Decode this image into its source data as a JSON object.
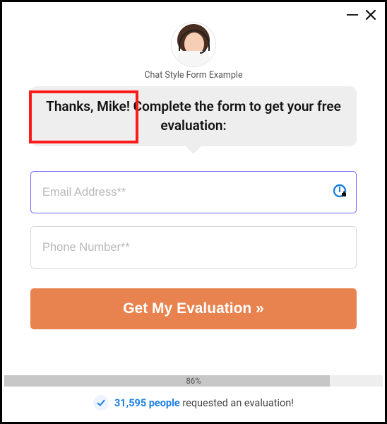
{
  "header": {
    "example_label": "Chat Style Form Example"
  },
  "bubble": {
    "text": "Thanks, Mike! Complete the form to get your free evaluation:"
  },
  "form": {
    "email_placeholder": "Email Address**",
    "phone_placeholder": "Phone Number**",
    "submit_label": "Get My Evaluation »"
  },
  "progress": {
    "percent": 86,
    "label": "86%"
  },
  "social_proof": {
    "count_text": "31,595 people",
    "rest_text": " requested an evaluation!"
  },
  "highlight": {
    "target": "Thanks, Mike!"
  },
  "colors": {
    "accent_orange": "#e8824e",
    "link_blue": "#1d7fe6",
    "focus_ring": "#6b66ff",
    "highlight_red": "#ff1a1a"
  }
}
